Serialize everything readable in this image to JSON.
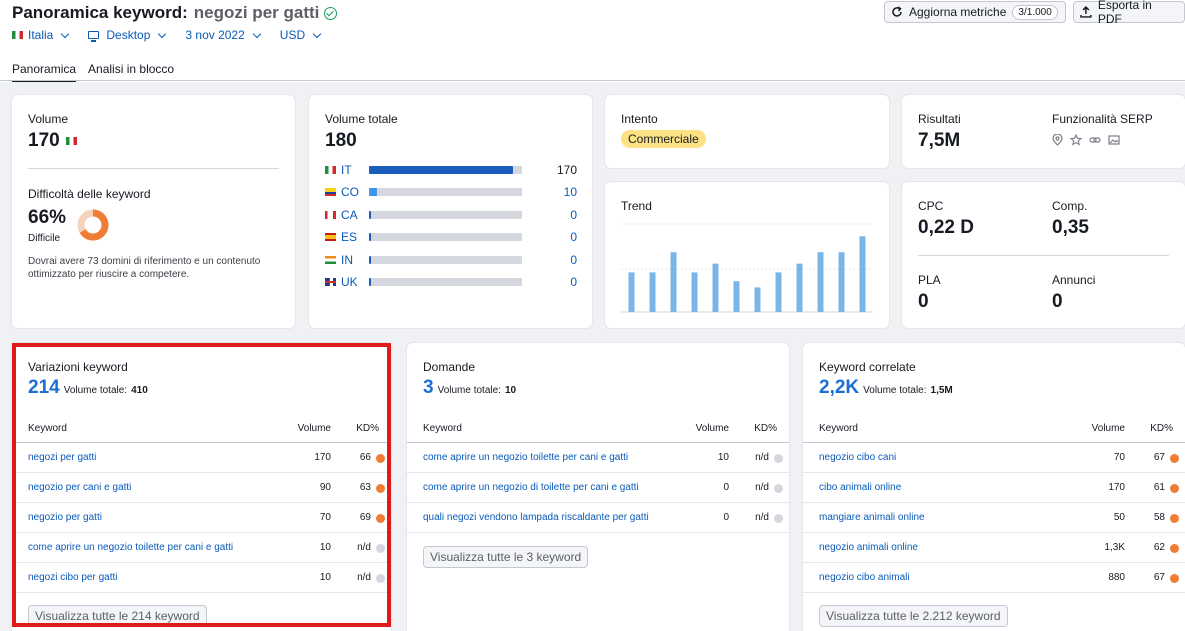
{
  "header": {
    "title_prefix": "Panoramica keyword:",
    "keyword": "negozi per gatti",
    "filters": {
      "country": "Italia",
      "device": "Desktop",
      "date": "3 nov 2022",
      "currency": "USD"
    },
    "update_label": "Aggiorna metriche",
    "update_counter": "3/1.000",
    "export_label": "Esporta in PDF",
    "tabs": [
      "Panoramica",
      "Analisi in blocco"
    ]
  },
  "volume": {
    "label": "Volume",
    "value": "170"
  },
  "difficulty": {
    "label": "Difficoltà delle keyword",
    "value": "66%",
    "level": "Difficile",
    "percent": 66,
    "description_1": "Dovrai avere 73 domini di riferimento e un contenuto",
    "description_2": "ottimizzato per riuscire a competere.",
    "color": "#f07d34"
  },
  "total_volume": {
    "label": "Volume totale",
    "value": "180",
    "countries": [
      {
        "code": "IT",
        "value": "170",
        "share": 0.94
      },
      {
        "code": "CO",
        "value": "10",
        "share": 0.05
      },
      {
        "code": "CA",
        "value": "0",
        "share": 0.005
      },
      {
        "code": "ES",
        "value": "0",
        "share": 0.005
      },
      {
        "code": "IN",
        "value": "0",
        "share": 0.005
      },
      {
        "code": "UK",
        "value": "0",
        "share": 0.005
      }
    ]
  },
  "intent": {
    "label": "Intento",
    "value": "Commerciale"
  },
  "trend": {
    "label": "Trend",
    "values": [
      0.45,
      0.45,
      0.68,
      0.45,
      0.55,
      0.35,
      0.28,
      0.45,
      0.55,
      0.68,
      0.68,
      0.86
    ]
  },
  "results": {
    "label": "Risultati",
    "value": "7,5M",
    "serp_label": "Funzionalità SERP"
  },
  "cpc": {
    "label": "CPC",
    "value": "0,22 D"
  },
  "comp": {
    "label": "Comp.",
    "value": "0,35"
  },
  "pla": {
    "label": "PLA",
    "value": "0"
  },
  "ads": {
    "label": "Annunci",
    "value": "0"
  },
  "col_labels": {
    "keyword": "Keyword",
    "volume": "Volume",
    "kd": "KD%",
    "total": "Volume totale:"
  },
  "variations": {
    "label": "Variazioni keyword",
    "count": "214",
    "total": "410",
    "rows": [
      {
        "kw": "negozi per gatti",
        "vol": "170",
        "kd": "66",
        "dot": "#f07d34"
      },
      {
        "kw": "negozio per cani e gatti",
        "vol": "90",
        "kd": "63",
        "dot": "#f07d34"
      },
      {
        "kw": "negozio per gatti",
        "vol": "70",
        "kd": "69",
        "dot": "#f07d34"
      },
      {
        "kw": "come aprire un negozio toilette per cani e gatti",
        "vol": "10",
        "kd": "n/d",
        "dot": "#d5d7de"
      },
      {
        "kw": "negozi cibo per gatti",
        "vol": "10",
        "kd": "n/d",
        "dot": "#d5d7de"
      }
    ],
    "button": "Visualizza tutte le 214 keyword"
  },
  "questions": {
    "label": "Domande",
    "count": "3",
    "total": "10",
    "rows": [
      {
        "kw": "come aprire un negozio toilette per cani e gatti",
        "vol": "10",
        "kd": "n/d",
        "dot": "#d5d7de"
      },
      {
        "kw": "come aprire un negozio di toilette per cani e gatti",
        "vol": "0",
        "kd": "n/d",
        "dot": "#d5d7de"
      },
      {
        "kw": "quali negozi vendono lampada riscaldante per gatti",
        "vol": "0",
        "kd": "n/d",
        "dot": "#d5d7de"
      }
    ],
    "button": "Visualizza tutte le 3 keyword"
  },
  "related": {
    "label": "Keyword correlate",
    "count": "2,2K",
    "total": "1,5M",
    "rows": [
      {
        "kw": "negozio cibo cani",
        "vol": "70",
        "kd": "67",
        "dot": "#f07d34"
      },
      {
        "kw": "cibo animali online",
        "vol": "170",
        "kd": "61",
        "dot": "#f07d34"
      },
      {
        "kw": "mangiare animali online",
        "vol": "50",
        "kd": "58",
        "dot": "#f07d34"
      },
      {
        "kw": "negozio animali online",
        "vol": "1,3K",
        "kd": "62",
        "dot": "#f07d34"
      },
      {
        "kw": "negozio cibo animali",
        "vol": "880",
        "kd": "67",
        "dot": "#f07d34"
      }
    ],
    "button": "Visualizza tutte le 2.212 keyword"
  },
  "colors": {
    "accent_blue": "#1b6ed6",
    "bar_blue": "#1b5dbd",
    "trend_blue": "#7ab5ea",
    "highlight_red": "#e01a1a"
  }
}
